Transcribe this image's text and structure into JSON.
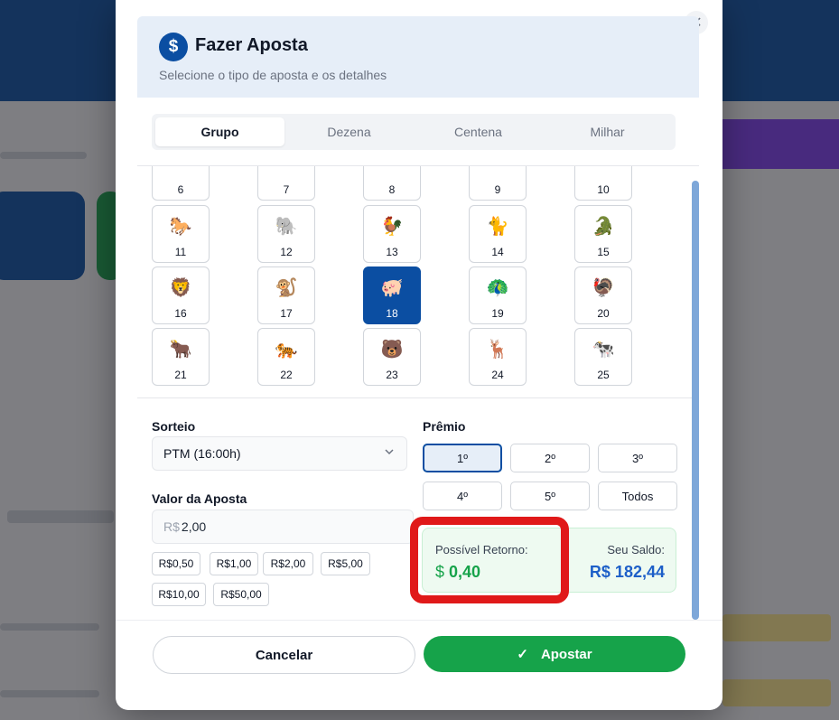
{
  "modal": {
    "title": "Fazer Aposta",
    "subtitle": "Selecione o tipo de aposta e os detalhes",
    "header_icon": "dollar-icon",
    "close_icon": "close-icon",
    "close_glyph": "✕",
    "dollar_glyph": "$"
  },
  "tabs": [
    {
      "label": "Grupo",
      "active": true
    },
    {
      "label": "Dezena",
      "active": false
    },
    {
      "label": "Centena",
      "active": false
    },
    {
      "label": "Milhar",
      "active": false
    }
  ],
  "groups": [
    {
      "number": "6",
      "icon": "partial-animal-icon",
      "emoji": ""
    },
    {
      "number": "7",
      "icon": "partial-animal-icon",
      "emoji": ""
    },
    {
      "number": "8",
      "icon": "partial-animal-icon",
      "emoji": ""
    },
    {
      "number": "9",
      "icon": "partial-animal-icon",
      "emoji": ""
    },
    {
      "number": "10",
      "icon": "partial-animal-icon",
      "emoji": ""
    },
    {
      "number": "11",
      "icon": "horse-icon",
      "emoji": "🐎"
    },
    {
      "number": "12",
      "icon": "elephant-icon",
      "emoji": "🐘"
    },
    {
      "number": "13",
      "icon": "rooster-icon",
      "emoji": "🐓"
    },
    {
      "number": "14",
      "icon": "cat-icon",
      "emoji": "🐈"
    },
    {
      "number": "15",
      "icon": "crocodile-icon",
      "emoji": "🐊"
    },
    {
      "number": "16",
      "icon": "lion-icon",
      "emoji": "🦁"
    },
    {
      "number": "17",
      "icon": "monkey-icon",
      "emoji": "🐒"
    },
    {
      "number": "18",
      "icon": "pig-icon",
      "emoji": "🐖",
      "selected": true
    },
    {
      "number": "19",
      "icon": "peacock-icon",
      "emoji": "🦚"
    },
    {
      "number": "20",
      "icon": "turkey-icon",
      "emoji": "🦃"
    },
    {
      "number": "21",
      "icon": "bull-icon",
      "emoji": "🐂"
    },
    {
      "number": "22",
      "icon": "tiger-icon",
      "emoji": "🐅"
    },
    {
      "number": "23",
      "icon": "bear-icon",
      "emoji": "🐻"
    },
    {
      "number": "24",
      "icon": "deer-icon",
      "emoji": "🦌"
    },
    {
      "number": "25",
      "icon": "cow-icon",
      "emoji": "🐄"
    }
  ],
  "draw": {
    "label": "Sorteio",
    "selected": "PTM (16:00h)",
    "chevron_icon": "chevron-down-icon"
  },
  "amount": {
    "label": "Valor da Aposta",
    "prefix": "R$",
    "value": "2,00",
    "quick_values": [
      "R$0,50",
      "R$1,00",
      "R$2,00",
      "R$5,00",
      "R$10,00",
      "R$50,00"
    ]
  },
  "prize": {
    "label": "Prêmio",
    "options": [
      "1º",
      "2º",
      "3º",
      "4º",
      "5º",
      "Todos"
    ],
    "selected": "1º"
  },
  "return": {
    "label": "Possível Retorno:",
    "prefix": "$",
    "value": "0,40",
    "balance_label": "Seu Saldo:",
    "balance_value": "R$ 182,44"
  },
  "footer": {
    "cancel_label": "Cancelar",
    "bet_label": "Apostar",
    "check_icon": "check-icon",
    "check_glyph": "✓"
  },
  "colors": {
    "primary": "#0b4ea2",
    "success": "#16a34a",
    "balance": "#1d5fc8",
    "annotation": "#e01919"
  }
}
